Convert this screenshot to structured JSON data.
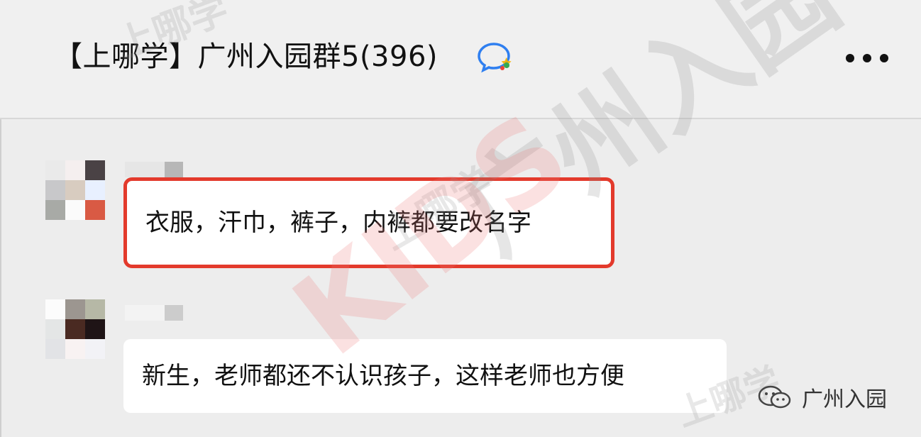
{
  "header": {
    "title": "【上哪学】广州入园群5(396)",
    "chat_icon": "group-chat-icon",
    "more_icon": "more-dots-icon"
  },
  "messages": [
    {
      "text": "衣服，汗巾，裤子，内裤都要改名字",
      "highlight_color": "#e33a2c",
      "avatar_colors": [
        "#eaeaea",
        "#f5efef",
        "#4a4245",
        "#c8c8ca",
        "#d8ccc0",
        "#e8f0ff",
        "#a8aaa6",
        "#fbfbfb",
        "#d95a44"
      ],
      "name_blocks": [
        "#e6e6e6",
        "#e6e6e6",
        "#b7b7b7"
      ]
    },
    {
      "text": "新生，老师都还不认识孩子，这样老师也方便",
      "avatar_colors": [
        "#fcfcfc",
        "#9c9690",
        "#b6b8a6",
        "#e4e6e6",
        "#4a2a22",
        "#1f1416",
        "#e2e3e6",
        "#f8f2f2",
        "#f2f2f6"
      ],
      "name_blocks": [
        "#f3f3f3",
        "#f3f3f3",
        "#cccccc"
      ]
    }
  ],
  "watermark": {
    "texts": [
      "上哪学",
      "广州入园",
      "上哪学",
      "KIDS",
      "上哪学"
    ]
  },
  "footer": {
    "label": "广州入园",
    "icon": "wechat-official-account-icon"
  },
  "colors": {
    "background": "#ededed",
    "bubble": "#ffffff",
    "highlight": "#e33a2c"
  }
}
